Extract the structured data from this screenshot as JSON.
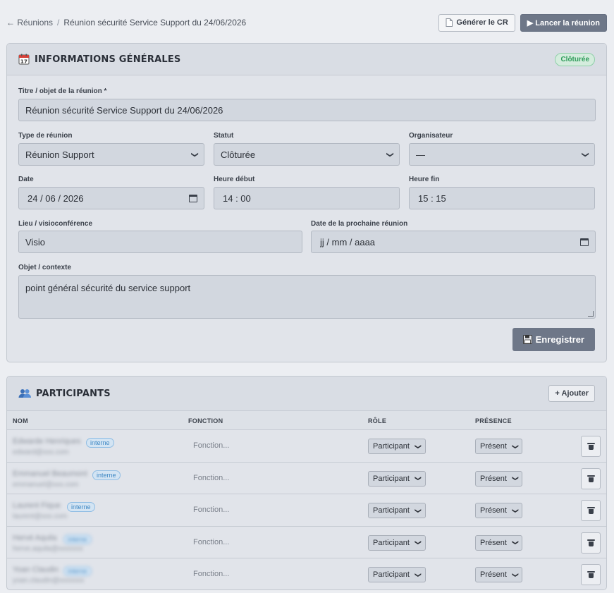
{
  "breadcrumb": {
    "back_label": "← Réunions",
    "separator": "/",
    "current": "Réunion sécurité Service Support du 24/06/2026"
  },
  "actions": {
    "generate_label": "Générer le CR",
    "generate_icon": "document-icon",
    "launch_label": "▶ Lancer la réunion"
  },
  "info": {
    "title": "INFORMATIONS GÉNÉRALES",
    "icon": "calendar-icon",
    "status_badge": "Clôturée",
    "fields": {
      "titre_label": "Titre / objet de la réunion *",
      "titre_value": "Réunion sécurité Service Support du 24/06/2026",
      "type_label": "Type de réunion",
      "type_value": "Réunion Support",
      "statut_label": "Statut",
      "statut_value": "Clôturée",
      "organisateur_label": "Organisateur",
      "organisateur_value": "—",
      "date_label": "Date",
      "date_value": "24 / 06 / 2026",
      "heure_debut_label": "Heure début",
      "heure_debut_value": "14 : 00",
      "heure_fin_label": "Heure fin",
      "heure_fin_value": "15 : 15",
      "lieu_label": "Lieu / visioconférence",
      "lieu_value": "Visio",
      "prochaine_label": "Date de la prochaine réunion",
      "prochaine_placeholder": "jj / mm / aaaa",
      "objet_label": "Objet / contexte",
      "objet_value": "point général sécurité du service support"
    },
    "save_label": "Enregistrer",
    "save_icon": "floppy-disk-icon"
  },
  "participants": {
    "title": "PARTICIPANTS",
    "icon": "people-icon",
    "add_label": "+ Ajouter",
    "columns": [
      "NOM",
      "FONCTION",
      "RÔLE",
      "PRÉSENCE"
    ],
    "function_placeholder": "Fonction...",
    "rows": [
      {
        "name": "Edwarde Henriques",
        "email": "edward@xxx.com",
        "tag": "interne",
        "role": "Participant",
        "presence": "Présent"
      },
      {
        "name": "Emmanuel Beaumont",
        "email": "emmanuel@xxx.com",
        "tag": "interne",
        "role": "Participant",
        "presence": "Présent"
      },
      {
        "name": "Laurent Fique",
        "email": "laurent@xxx.com",
        "tag": "interne",
        "role": "Participant",
        "presence": "Présent"
      },
      {
        "name": "Hervé Aquila",
        "email": "herve.aquila@xxxxxxx",
        "tag": "interne",
        "role": "Participant",
        "presence": "Présent"
      },
      {
        "name": "Yoan Claudin",
        "email": "yoan.claudin@xxxxxxx",
        "tag": "interne",
        "role": "Participant",
        "presence": "Présent"
      }
    ]
  }
}
